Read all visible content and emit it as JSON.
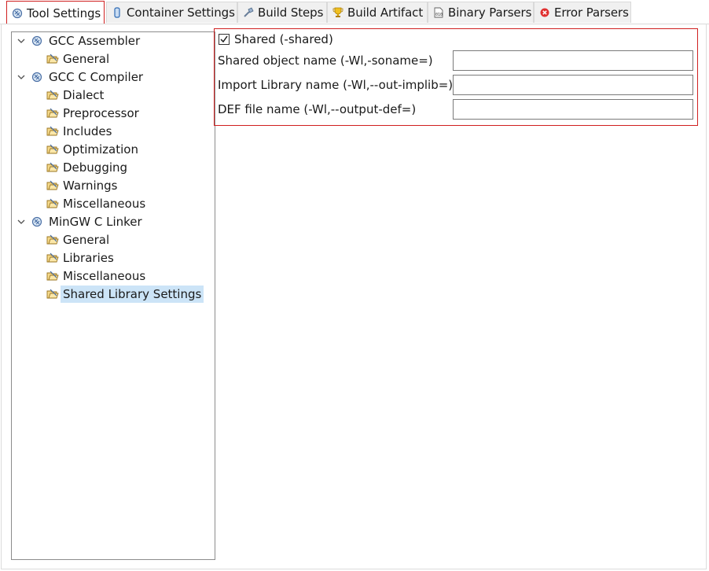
{
  "tabs": [
    {
      "label": "Tool Settings",
      "icon": "tool-settings-icon",
      "active": true
    },
    {
      "label": "Container Settings",
      "icon": "container-icon"
    },
    {
      "label": "Build Steps",
      "icon": "build-steps-icon"
    },
    {
      "label": "Build Artifact",
      "icon": "trophy-icon"
    },
    {
      "label": "Binary Parsers",
      "icon": "binary-icon"
    },
    {
      "label": "Error Parsers",
      "icon": "error-icon"
    }
  ],
  "tree": {
    "tools": [
      {
        "label": "GCC Assembler",
        "expanded": true,
        "children": [
          "General"
        ]
      },
      {
        "label": "GCC C Compiler",
        "expanded": true,
        "children": [
          "Dialect",
          "Preprocessor",
          "Includes",
          "Optimization",
          "Debugging",
          "Warnings",
          "Miscellaneous"
        ]
      },
      {
        "label": "MinGW C Linker",
        "expanded": true,
        "children": [
          "General",
          "Libraries",
          "Miscellaneous",
          "Shared Library Settings"
        ]
      }
    ],
    "selected": "Shared Library Settings"
  },
  "options": {
    "shared_label": "Shared (-shared)",
    "shared_checked": true,
    "fields": [
      {
        "label": "Shared object name (-Wl,-soname=)",
        "value": ""
      },
      {
        "label": "Import Library name (-Wl,--out-implib=)",
        "value": ""
      },
      {
        "label": "DEF file name (-Wl,--output-def=)",
        "value": ""
      }
    ]
  },
  "colors": {
    "highlight_border": "#d02020",
    "selection": "#cce4f7"
  }
}
